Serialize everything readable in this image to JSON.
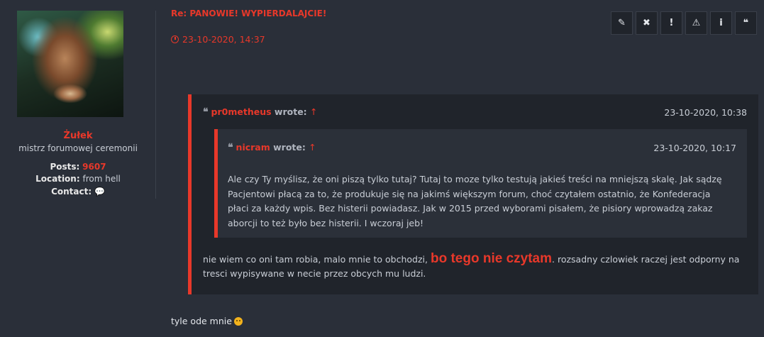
{
  "profile": {
    "username": "Żułek",
    "rank": "mistrz forumowej ceremonii",
    "posts_label": "Posts:",
    "posts_value": "9607",
    "location_label": "Location:",
    "location_value": "from hell",
    "contact_label": "Contact:"
  },
  "post": {
    "title": "Re: PANOWIE! WYPIERDALAJCIE!",
    "date": "23-10-2020, 14:37",
    "final_line": "tyle ode mnie"
  },
  "actions": [
    {
      "glyph": "✎",
      "icon": "pencil-icon"
    },
    {
      "glyph": "✖",
      "icon": "delete-icon"
    },
    {
      "glyph": "!",
      "icon": "exclamation-icon"
    },
    {
      "glyph": "⚠",
      "icon": "warning-icon"
    },
    {
      "glyph": "i",
      "icon": "info-icon"
    },
    {
      "glyph": "❝",
      "icon": "quote-icon"
    }
  ],
  "outer_quote": {
    "author": "pr0metheus",
    "wrote": "wrote:",
    "arrow": "↑",
    "date": "23-10-2020, 10:38",
    "text_before": "nie wiem co oni tam robia, malo mnie to obchodzi, ",
    "text_big": "bo tego nie czytam",
    "text_after": ". rozsadny czlowiek raczej jest odporny na tresci wypisywane w necie przez obcych mu ludzi."
  },
  "inner_quote": {
    "author": "nicram",
    "wrote": "wrote:",
    "arrow": "↑",
    "date": "23-10-2020, 10:17",
    "text": "Ale czy Ty myślisz, że oni piszą tylko tutaj? Tutaj to moze tylko testują jakieś treści na mniejszą skalę. Jak sądzę Pacjentowi płacą za to, że produkuje się na jakimś większym forum, choć czytałem ostatnio, że Konfederacja płaci za każdy wpis. Bez histerii powiadasz. Jak w 2015 przed wyborami pisałem, że pisiory wprowadzą zakaz aborcji to też było bez histerii. I wczoraj jeb!"
  },
  "colors": {
    "accent": "#e8382a",
    "background": "#2a2f39",
    "quote_bg": "#20242b",
    "nested_quote_bg": "#2b3039"
  }
}
